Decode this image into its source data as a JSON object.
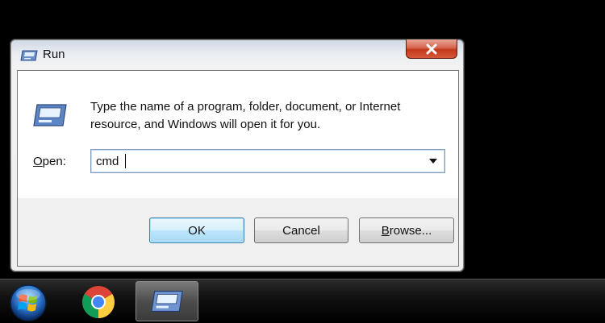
{
  "window": {
    "title": "Run",
    "close_icon": "close-icon"
  },
  "dialog": {
    "description_line1": "Type the name of a program, folder, document, or Internet",
    "description_line2": "resource, and Windows will open it for you.",
    "open_label_mnemonic": "O",
    "open_label_rest": "pen:",
    "open_value": "cmd",
    "buttons": {
      "ok": "OK",
      "cancel": "Cancel",
      "browse_mnemonic": "B",
      "browse_rest": "rowse..."
    }
  },
  "taskbar": {
    "items": [
      "start-orb-icon",
      "chrome-icon",
      "run-icon"
    ]
  },
  "colors": {
    "close_red": "#c2391c",
    "default_button_border": "#3c7fb1",
    "combo_border": "#7f9db9"
  }
}
